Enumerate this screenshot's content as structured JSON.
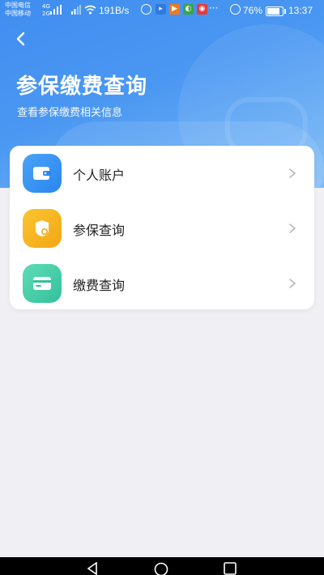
{
  "status_bar": {
    "carrier_1": "中国电信",
    "carrier_2": "中国移动",
    "net_1": "4G",
    "net_2": "2G",
    "speed": "191B/s",
    "dots": "···",
    "battery": "76%",
    "battery_level": 0.76,
    "time": "13:37"
  },
  "header": {
    "title": "参保缴费查询",
    "subtitle": "查看参保缴费相关信息",
    "back_icon": "chevron-left-icon"
  },
  "menu": [
    {
      "label": "个人账户",
      "icon": "wallet-icon",
      "color": "#2f8ef4"
    },
    {
      "label": "参保查询",
      "icon": "shield-icon",
      "color": "#f5b21b"
    },
    {
      "label": "缴费查询",
      "icon": "card-icon",
      "color": "#3fcda4"
    }
  ],
  "colors": {
    "hero_blue": "#3f8df0",
    "background": "#efeff4"
  }
}
